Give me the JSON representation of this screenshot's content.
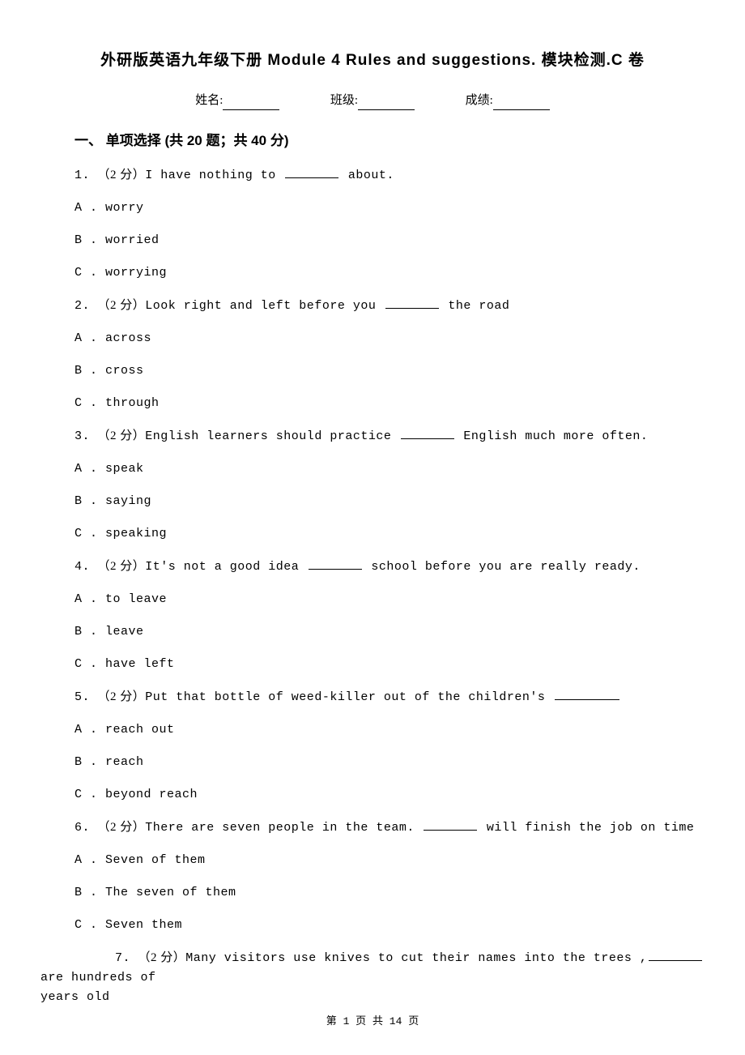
{
  "title": "外研版英语九年级下册 Module 4 Rules and suggestions. 模块检测.C 卷",
  "info": {
    "name_label": "姓名:",
    "class_label": "班级:",
    "score_label": "成绩:"
  },
  "section": {
    "header": "一、 单项选择 (共 20 题；共 40 分)"
  },
  "questions": [
    {
      "num": "1. ",
      "points": "（2 分）",
      "text_before": "I have nothing to ",
      "text_after": " about.",
      "options": [
        {
          "l": "A . ",
          "t": "worry"
        },
        {
          "l": "B . ",
          "t": "worried"
        },
        {
          "l": "C . ",
          "t": "worrying"
        }
      ]
    },
    {
      "num": "2. ",
      "points": "（2 分）",
      "text_before": "Look right and left before you ",
      "text_after": " the road",
      "options": [
        {
          "l": "A . ",
          "t": "across"
        },
        {
          "l": "B . ",
          "t": "cross"
        },
        {
          "l": "C . ",
          "t": "through"
        }
      ]
    },
    {
      "num": "3. ",
      "points": "（2 分）",
      "text_before": "English learners should practice ",
      "text_after": " English much more often.",
      "options": [
        {
          "l": "A . ",
          "t": "speak"
        },
        {
          "l": "B . ",
          "t": "saying"
        },
        {
          "l": "C . ",
          "t": "speaking"
        }
      ]
    },
    {
      "num": "4. ",
      "points": "（2 分）",
      "text_before": "It's  not a good idea ",
      "text_after": " school before you are really ready.",
      "options": [
        {
          "l": "A . ",
          "t": "to leave"
        },
        {
          "l": "B . ",
          "t": "leave"
        },
        {
          "l": "C . ",
          "t": "have left"
        }
      ]
    },
    {
      "num": "5. ",
      "points": "（2 分）",
      "text_before": "Put that bottle of weed-killer out of the children's ",
      "text_after": "",
      "options": [
        {
          "l": "A . ",
          "t": "reach out"
        },
        {
          "l": "B . ",
          "t": "reach"
        },
        {
          "l": "C . ",
          "t": "beyond reach"
        }
      ]
    },
    {
      "num": "6. ",
      "points": "（2 分）",
      "text_before": "There are seven people in the team. ",
      "text_after": " will finish the job on time",
      "options": [
        {
          "l": "A . ",
          "t": "Seven of them"
        },
        {
          "l": "B . ",
          "t": "The seven of them"
        },
        {
          "l": "C . ",
          "t": "Seven them"
        }
      ]
    }
  ],
  "q7": {
    "num": "7. ",
    "points": "（2 分）",
    "line1_before": "Many visitors use knives to cut their names into the trees ,",
    "line1_after": " are hundreds of",
    "line2": "years old"
  },
  "footer": "第 1 页 共 14 页"
}
